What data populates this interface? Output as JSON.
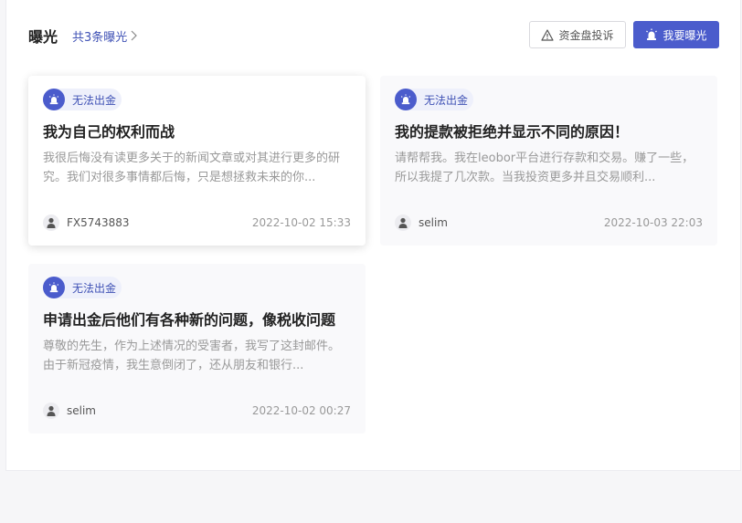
{
  "header": {
    "title": "曝光",
    "count_link": "共3条曝光"
  },
  "toolbar": {
    "complaint_label": "资金盘投诉",
    "expose_label": "我要曝光"
  },
  "colors": {
    "accent": "#4b5ccc",
    "tag_bg": "#eef0fb"
  },
  "cards": [
    {
      "tag": "无法出金",
      "title": "我为自己的权利而战",
      "excerpt": "我很后悔没有读更多关于的新闻文章或对其进行更多的研究。我们对很多事情都后悔，只是想拯救未来的你...",
      "author": "FX5743883",
      "date": "2022-10-02 15:33"
    },
    {
      "tag": "无法出金",
      "title": "我的提款被拒绝并显示不同的原因！",
      "excerpt": "请帮帮我。我在leobor平台进行存款和交易。赚了一些，所以我提了几次款。当我投资更多并且交易顺利...",
      "author": "selim",
      "date": "2022-10-03 22:03"
    },
    {
      "tag": "无法出金",
      "title": "申请出金后他们有各种新的问题，像税收问题",
      "excerpt": "尊敬的先生，作为上述情况的受害者，我写了这封邮件。由于新冠疫情，我生意倒闭了，还从朋友和银行...",
      "author": "selim",
      "date": "2022-10-02 00:27"
    }
  ]
}
